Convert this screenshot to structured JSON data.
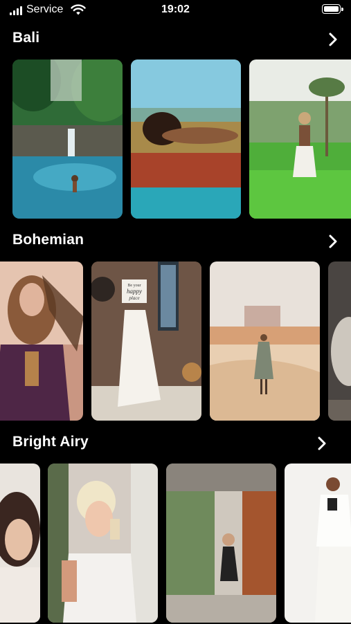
{
  "status_bar": {
    "carrier": "Service",
    "time": "19:02",
    "icons": [
      "signal-icon",
      "wifi-icon",
      "battery-icon"
    ]
  },
  "sections": [
    {
      "title": "Bali",
      "chevron_icon": "chevron-right-icon",
      "photos": [
        "jungle-waterfall-pool",
        "woman-lying-by-pool",
        "woman-in-rice-field"
      ]
    },
    {
      "title": "Bohemian",
      "chevron_icon": "chevron-right-icon",
      "photos": [
        "boho-woman-feather",
        "woman-holding-sign",
        "woman-in-desert",
        "hanging-chair-partial"
      ]
    },
    {
      "title": "Bright Airy",
      "chevron_icon": "chevron-right-icon",
      "photos": [
        "woman-portrait-partial",
        "blonde-woman-ice-cream",
        "woman-on-balcony",
        "woman-in-white-suit"
      ]
    }
  ],
  "sign_text": [
    "Be your",
    "happy",
    "place"
  ],
  "colors": {
    "background": "#000000",
    "text": "#ffffff"
  }
}
